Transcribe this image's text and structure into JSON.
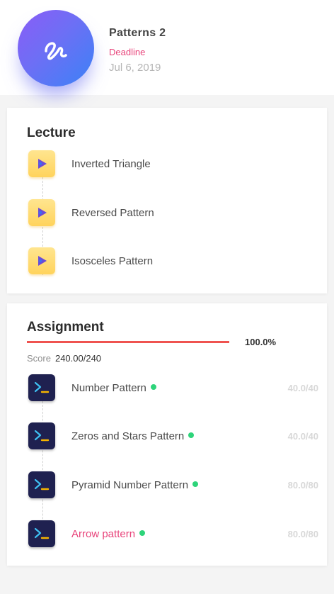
{
  "course": {
    "title": "Patterns 2",
    "deadline_label": "Deadline",
    "deadline_date": "Jul 6, 2019",
    "logo_icon": "squiggle-icon",
    "logo_gradient": [
      "#8b5cf6",
      "#3b82f6"
    ]
  },
  "lecture": {
    "title": "Lecture",
    "items": [
      {
        "label": "Inverted Triangle",
        "icon": "play-video-icon"
      },
      {
        "label": "Reversed Pattern",
        "icon": "play-video-icon"
      },
      {
        "label": "Isosceles Pattern",
        "icon": "play-video-icon"
      }
    ]
  },
  "assignment": {
    "title": "Assignment",
    "progress_value": 1.0,
    "progress_text": "100.0%",
    "score_label": "Score",
    "score_value": "240.00/240",
    "items": [
      {
        "label": "Number Pattern",
        "score": "40.0/40",
        "status": "complete",
        "icon": "terminal-icon"
      },
      {
        "label": "Zeros and Stars Pattern",
        "score": "40.0/40",
        "status": "complete",
        "icon": "terminal-icon"
      },
      {
        "label": "Pyramid Number Pattern",
        "score": "80.0/80",
        "status": "complete",
        "icon": "terminal-icon"
      },
      {
        "label": "Arrow pattern",
        "score": "80.0/80",
        "status": "complete",
        "icon": "terminal-icon",
        "active": true
      }
    ]
  },
  "colors": {
    "accent_pink": "#e8437a",
    "progress_red": "#ef5350",
    "status_green": "#2ed47a",
    "lecture_icon_yellow": "#ffd35c",
    "terminal_navy": "#1f2150"
  }
}
